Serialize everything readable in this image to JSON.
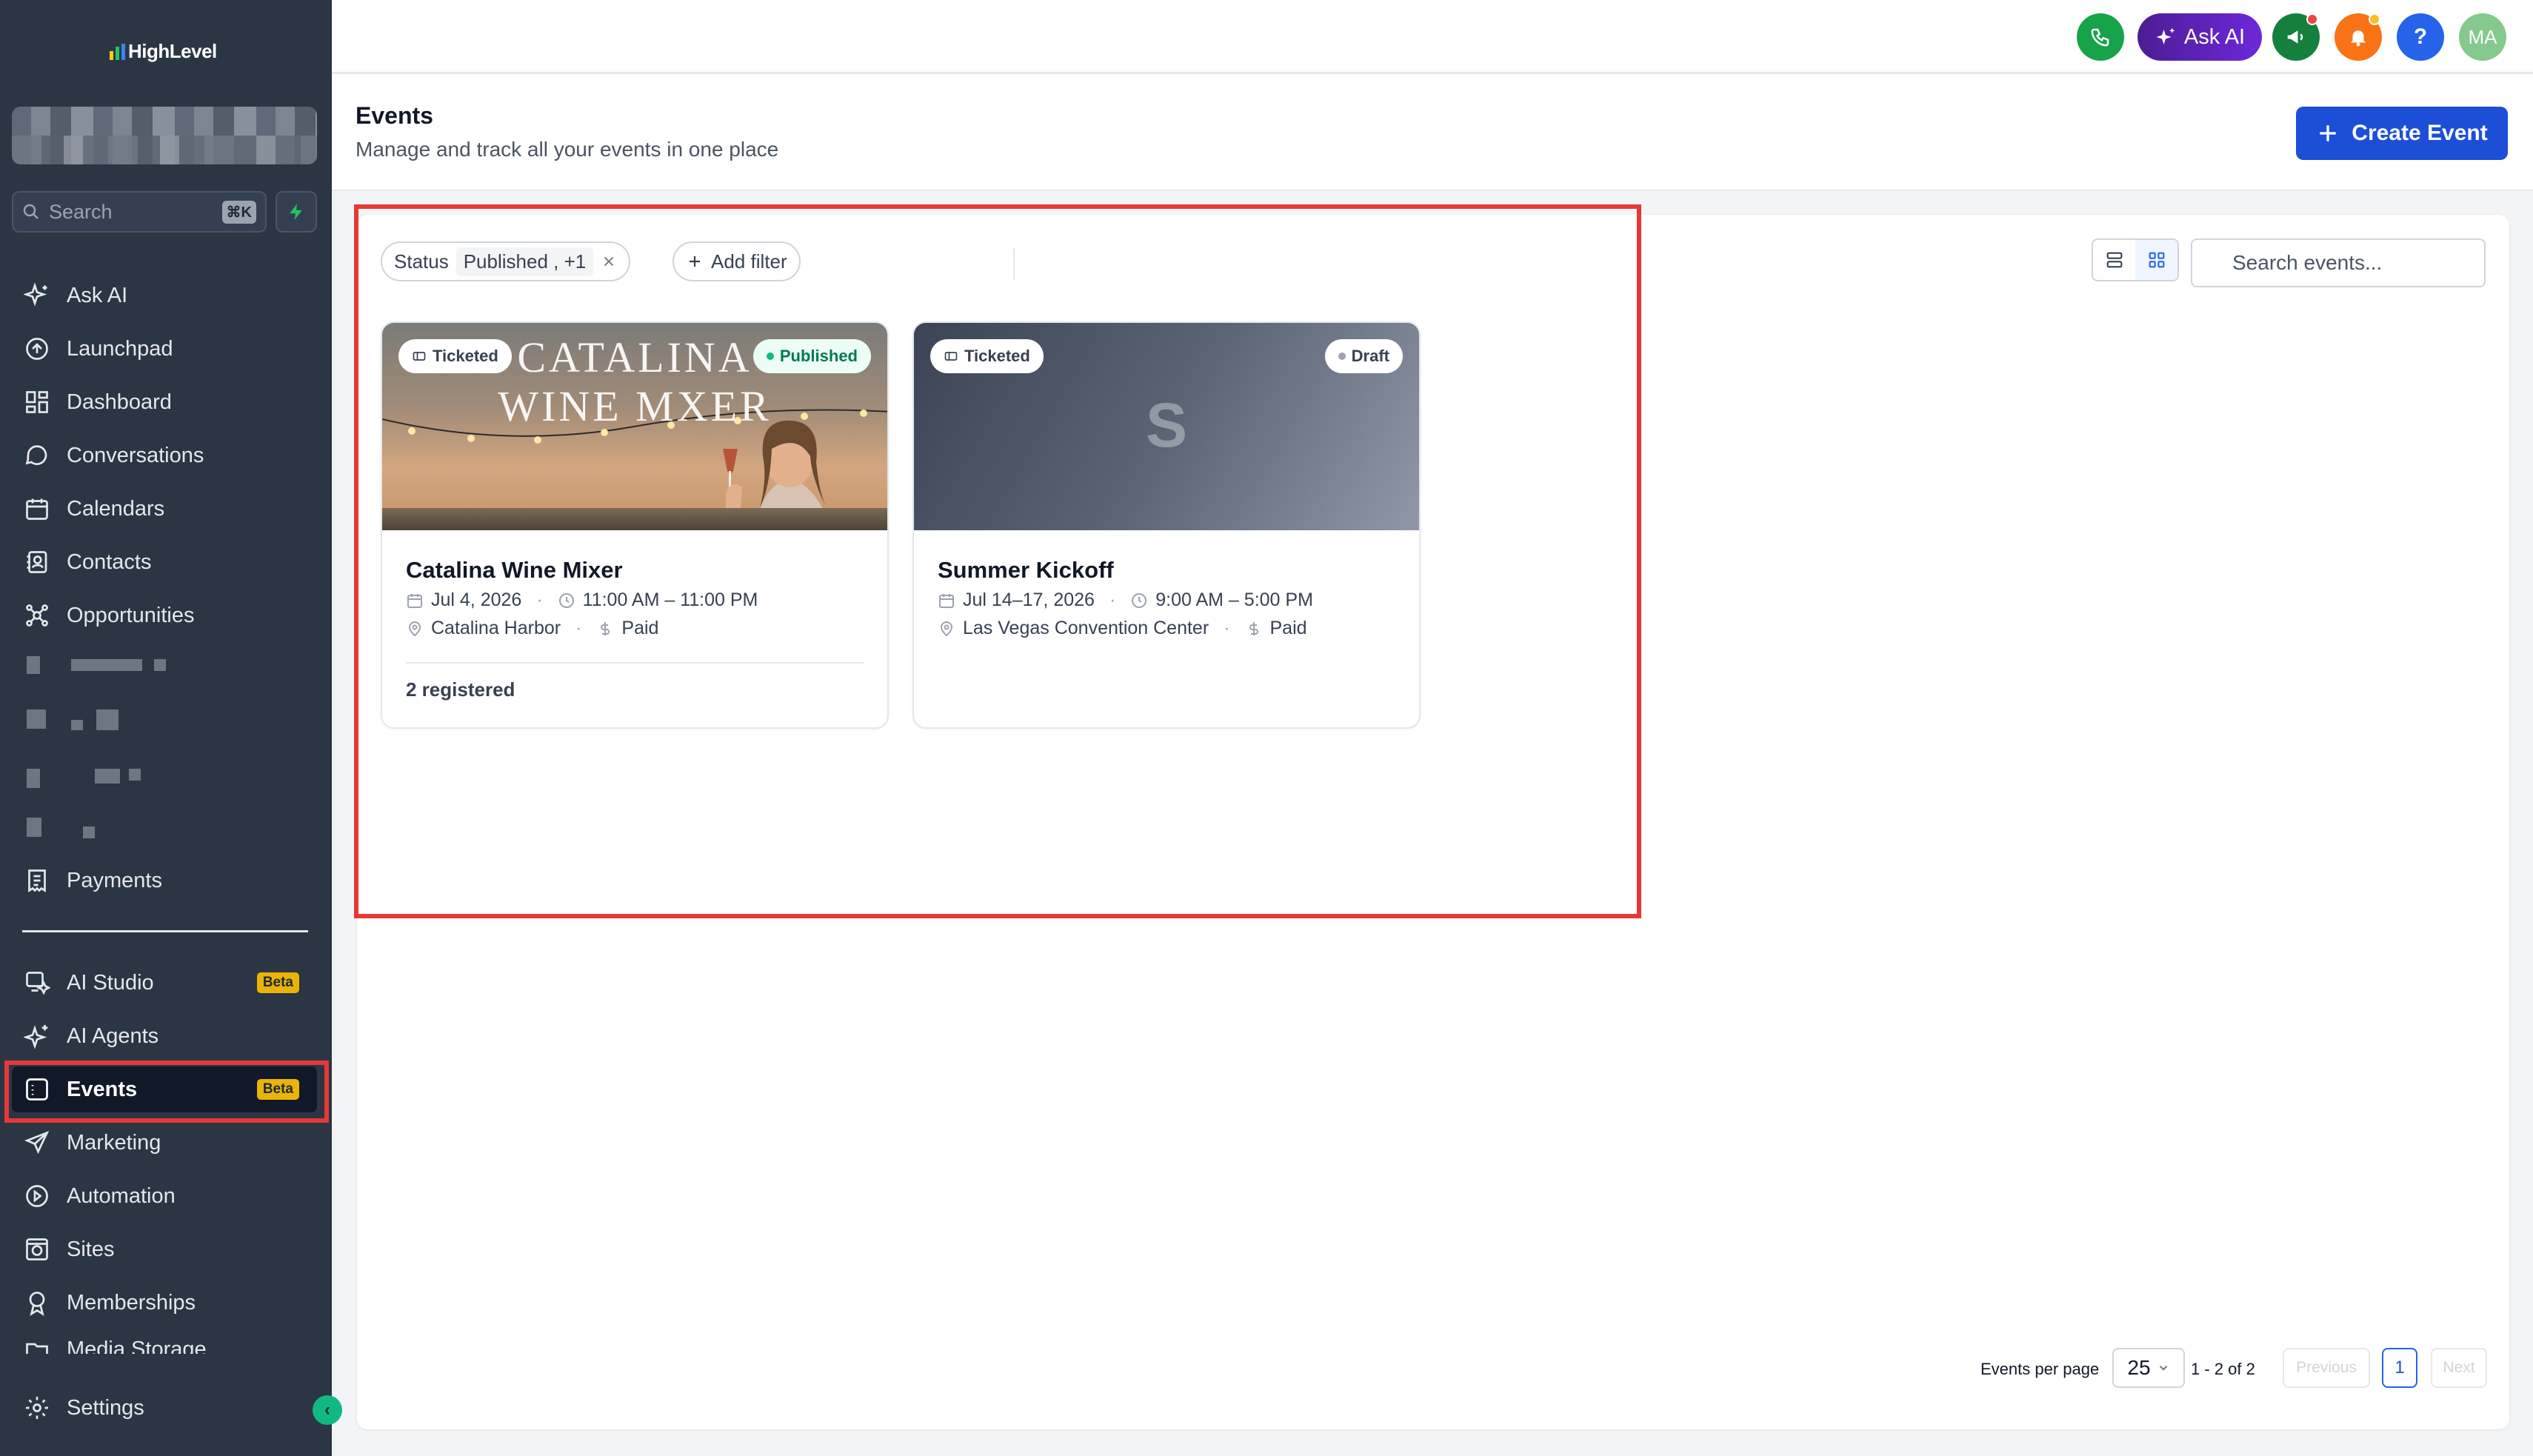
{
  "app": {
    "name": "HighLevel"
  },
  "sidebar": {
    "search_placeholder": "Search",
    "search_shortcut": "⌘K",
    "items": [
      {
        "label": "Ask AI",
        "icon": "sparkle-icon"
      },
      {
        "label": "Launchpad",
        "icon": "rocket-icon"
      },
      {
        "label": "Dashboard",
        "icon": "grid-icon"
      },
      {
        "label": "Conversations",
        "icon": "chat-bubble-icon"
      },
      {
        "label": "Calendars",
        "icon": "calendar-icon"
      },
      {
        "label": "Contacts",
        "icon": "contacts-icon"
      },
      {
        "label": "Opportunities",
        "icon": "network-icon"
      },
      {
        "label": "Payments",
        "icon": "receipt-icon"
      }
    ],
    "secondary_items": [
      {
        "label": "AI Studio",
        "icon": "ai-studio-icon",
        "badge": "Beta"
      },
      {
        "label": "AI Agents",
        "icon": "sparkle-icon"
      },
      {
        "label": "Events",
        "icon": "events-icon",
        "badge": "Beta",
        "active": true
      },
      {
        "label": "Marketing",
        "icon": "send-icon"
      },
      {
        "label": "Automation",
        "icon": "automation-icon"
      },
      {
        "label": "Sites",
        "icon": "globe-icon"
      },
      {
        "label": "Memberships",
        "icon": "award-icon"
      },
      {
        "label": "Media Storage",
        "icon": "folder-icon"
      }
    ],
    "settings_label": "Settings"
  },
  "topbar": {
    "ask_ai_label": "Ask AI",
    "avatar_initials": "MA",
    "help_label": "?"
  },
  "header": {
    "title": "Events",
    "subtitle": "Manage and track all your events in one place",
    "create_button": "Create Event"
  },
  "filters": {
    "status_label": "Status",
    "status_value": "Published , +1",
    "add_filter": "Add filter",
    "search_placeholder": "Search events..."
  },
  "events": [
    {
      "title": "Catalina Wine Mixer",
      "image_text_line1": "CATALINA",
      "image_text_line2": "WINE MXER",
      "type_badge": "Ticketed",
      "status_badge": "Published",
      "date": "Jul 4, 2026",
      "time": "11:00 AM – 11:00 PM",
      "location": "Catalina Harbor",
      "price": "Paid",
      "registered": "2 registered"
    },
    {
      "title": "Summer Kickoff",
      "image_initial": "S",
      "type_badge": "Ticketed",
      "status_badge": "Draft",
      "date": "Jul 14–17, 2026",
      "time": "9:00 AM – 5:00 PM",
      "location": "Las Vegas Convention Center",
      "price": "Paid"
    }
  ],
  "pagination": {
    "per_page_label": "Events per page",
    "per_page_value": "25",
    "range": "1 - 2 of 2",
    "previous": "Previous",
    "current_page": "1",
    "next": "Next"
  },
  "colors": {
    "sidebar_bg": "#2b3544",
    "primary": "#1d4ed8",
    "highlight_box": "#e53935",
    "beta_badge": "#eab308"
  }
}
